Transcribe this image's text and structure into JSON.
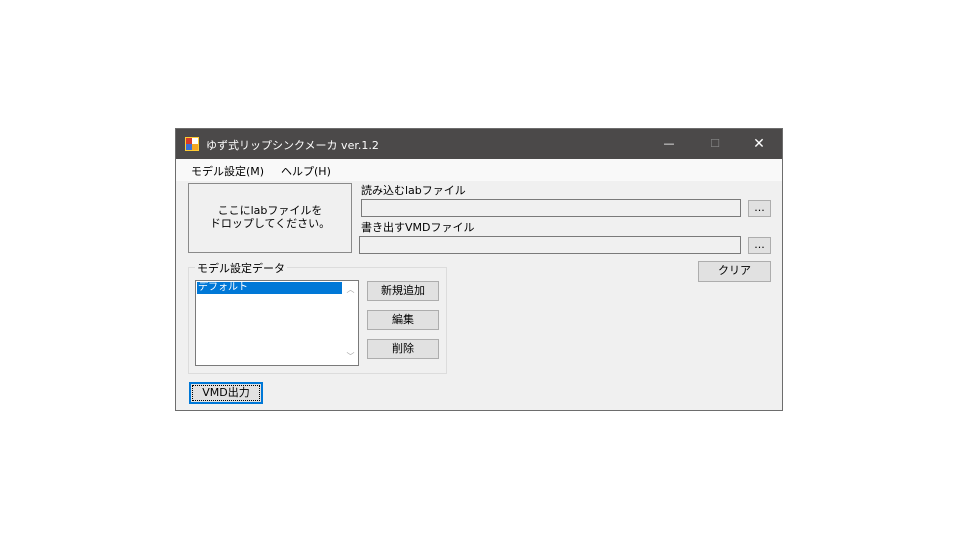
{
  "window": {
    "title": "ゆず式リップシンクメーカ ver.1.2",
    "minimize": "—",
    "maximize": "☐",
    "close": "✕"
  },
  "menu": {
    "items": [
      "モデル設定(M)",
      "ヘルプ(H)"
    ]
  },
  "dropzone": {
    "line1": "ここにlabファイルを",
    "line2": "ドロップしてください。"
  },
  "lab_file": {
    "label": "読み込むlabファイル",
    "value": "",
    "browse": "..."
  },
  "vmd_file": {
    "label": "書き出すVMDファイル",
    "value": "",
    "browse": "..."
  },
  "clear_button": "クリア",
  "model_group": {
    "title": "モデル設定データ",
    "items": [
      "デフォルト"
    ],
    "selected": 0,
    "add_button": "新規追加",
    "edit_button": "編集",
    "delete_button": "削除"
  },
  "output_button": "VMD出力"
}
